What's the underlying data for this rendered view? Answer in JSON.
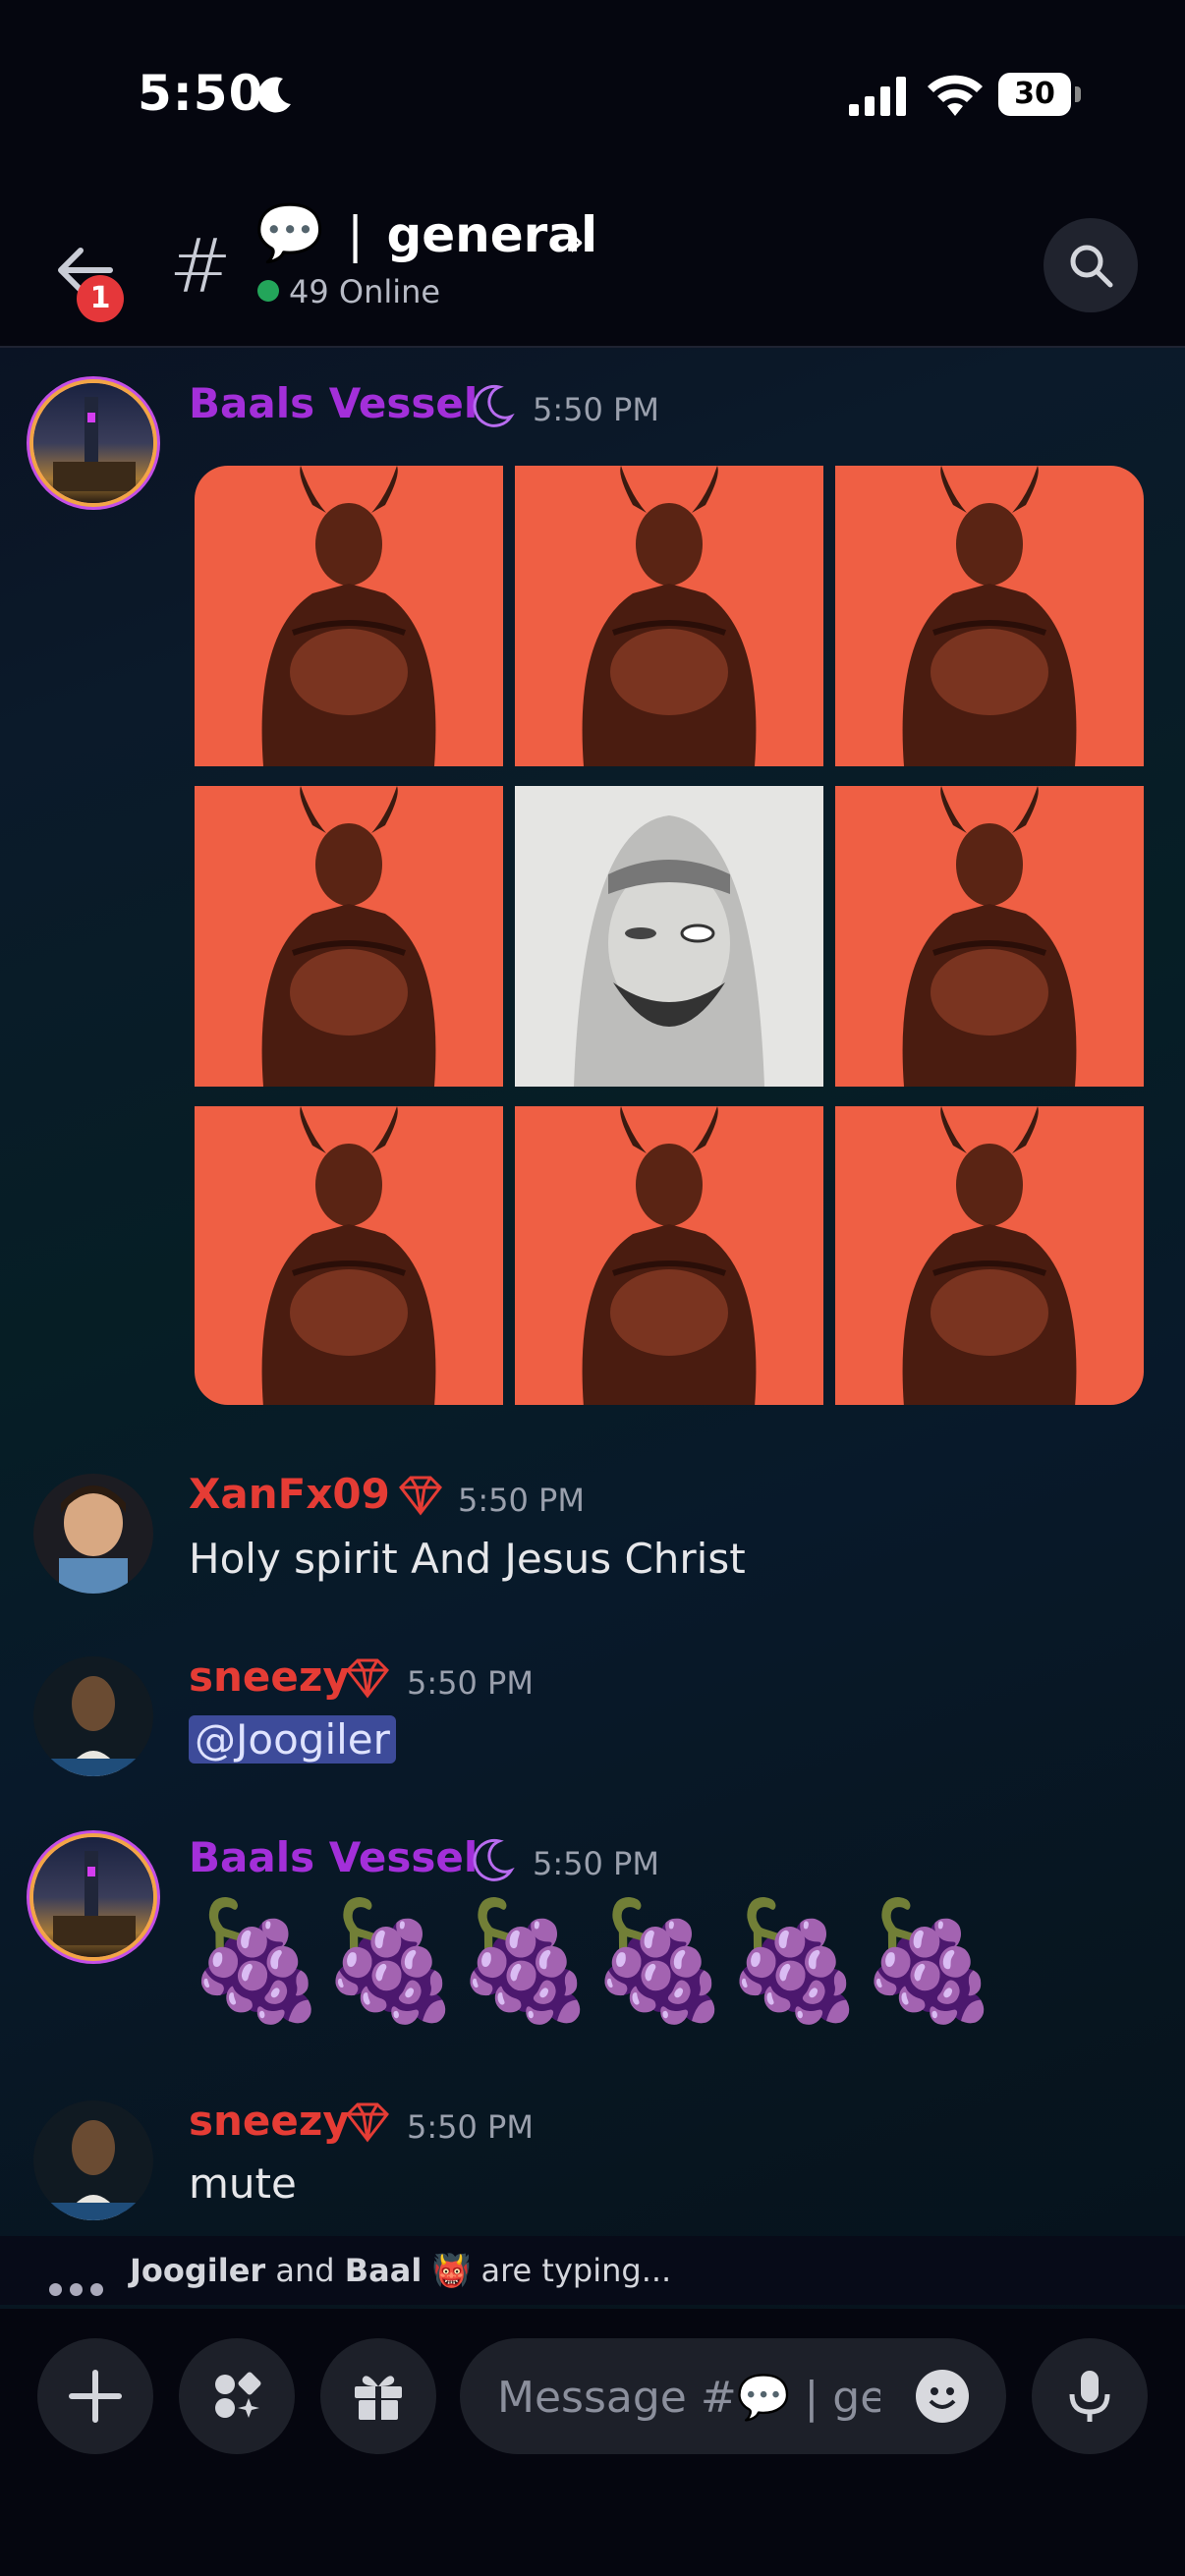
{
  "status_bar": {
    "time": "5:50",
    "battery": "30"
  },
  "header": {
    "back_badge": "1",
    "channel_hash": "#",
    "channel_emoji": "💬",
    "channel_separator": "|",
    "channel_name": "general",
    "chevron": "›",
    "online_text": "49 Online"
  },
  "messages": [
    {
      "author": "Baals Vessel",
      "author_color": "#a32fd9",
      "badge": "moon",
      "time": "5:50 PM",
      "content_type": "image-grid"
    },
    {
      "author": "XanFx09",
      "author_color": "#e53c35",
      "badge": "gem",
      "time": "5:50 PM",
      "text": "Holy spirit And Jesus Christ"
    },
    {
      "author": "sneezy",
      "author_color": "#e53c35",
      "badge": "gem",
      "time": "5:50 PM",
      "text": "@Joogiler"
    },
    {
      "author": "Baals Vessel",
      "author_color": "#a32fd9",
      "badge": "moon",
      "time": "5:50 PM",
      "text": "🍇🍇🍇🍇🍇🍇"
    },
    {
      "author": "sneezy",
      "author_color": "#e53c35",
      "badge": "gem",
      "time": "5:50 PM",
      "text": "mute"
    }
  ],
  "typing": {
    "user1": "Joogiler",
    "and": "and",
    "user2": "Baal",
    "user2_emoji": "👹",
    "suffix": "are typing..."
  },
  "composer": {
    "placeholder": "Message #💬 | gen"
  }
}
